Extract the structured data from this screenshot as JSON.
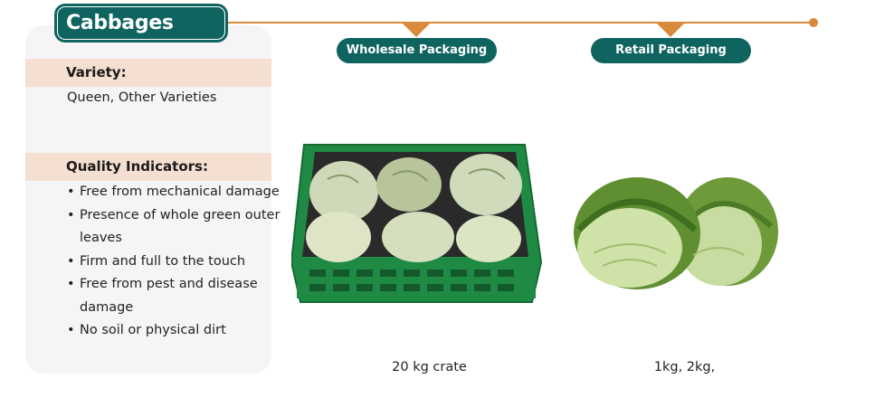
{
  "title": "Cabbages",
  "packaging": {
    "wholesale_label": "Wholesale Packaging",
    "retail_label": "Retail Packaging",
    "wholesale_caption": "20 kg crate",
    "retail_caption": "1kg, 2kg,"
  },
  "variety": {
    "heading": "Variety:",
    "text": "Queen, Other Varieties"
  },
  "quality": {
    "heading": "Quality Indicators:",
    "items": [
      "Free from mechanical damage",
      "Presence of whole green outer leaves",
      "Firm and full to the touch",
      "Free from pest and disease damage",
      "No soil or physical dirt"
    ]
  },
  "colors": {
    "teal": "#0f6460",
    "orange": "#d98a3a",
    "band": "#f5dfd0",
    "panel": "#f5f5f5"
  }
}
